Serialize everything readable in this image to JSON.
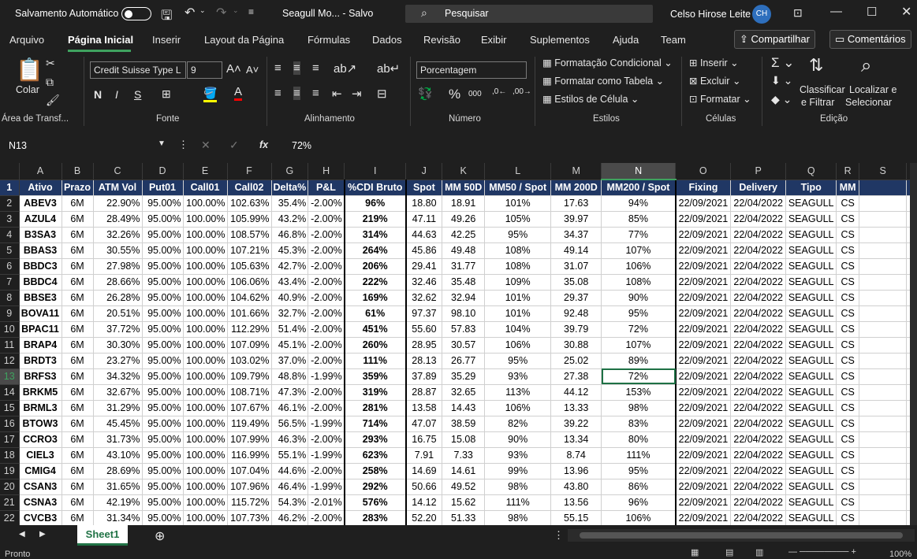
{
  "titlebar": {
    "autosave_label": "Salvamento Automático",
    "doc_title": "Seagull Mo...  -  Salvo",
    "search_placeholder": "Pesquisar",
    "user_name": "Celso Hirose Leite",
    "user_initials": "CH"
  },
  "menu": {
    "items": [
      "Arquivo",
      "Página Inicial",
      "Inserir",
      "Layout da Página",
      "Fórmulas",
      "Dados",
      "Revisão",
      "Exibir",
      "Suplementos",
      "Ajuda",
      "Team"
    ],
    "share": "Compartilhar",
    "comments": "Comentários"
  },
  "ribbon": {
    "paste": "Colar",
    "font_name": "Credit Suisse Type L",
    "font_size": "9",
    "number_format": "Porcentagem",
    "cond_format": "Formatação Condicional",
    "format_table": "Formatar como Tabela",
    "cell_styles": "Estilos de Célula",
    "insert": "Inserir",
    "delete": "Excluir",
    "format": "Formatar",
    "sort1": "Classificar",
    "sort2": "e Filtrar",
    "find1": "Localizar e",
    "find2": "Selecionar",
    "bold": "N",
    "italic": "I",
    "underline": "S",
    "groups": {
      "clipboard": "Área de Transf...",
      "font": "Fonte",
      "alignment": "Alinhamento",
      "number": "Número",
      "styles": "Estilos",
      "cells": "Células",
      "editing": "Edição"
    }
  },
  "formula": {
    "name_box": "N13",
    "fx": "fx",
    "value": "72%"
  },
  "columns": [
    "A",
    "B",
    "C",
    "D",
    "E",
    "F",
    "G",
    "H",
    "I",
    "J",
    "K",
    "L",
    "M",
    "N",
    "O",
    "P",
    "Q",
    "R",
    "S"
  ],
  "headers": [
    "Ativo",
    "Prazo",
    "ATM Vol",
    "Put01",
    "Call01",
    "Call02",
    "Delta%",
    "P&L",
    "%CDI Bruto",
    "Spot",
    "MM 50D",
    "MM50 / Spot",
    "MM 200D",
    "MM200 / Spot",
    "Fixing",
    "Delivery",
    "Tipo",
    "MM",
    ""
  ],
  "rows": [
    [
      "ABEV3",
      "6M",
      "22.90%",
      "95.00%",
      "100.00%",
      "102.63%",
      "35.4%",
      "-2.00%",
      "96%",
      "18.80",
      "18.91",
      "101%",
      "17.63",
      "94%",
      "22/09/2021",
      "22/04/2022",
      "SEAGULL",
      "CS"
    ],
    [
      "AZUL4",
      "6M",
      "28.49%",
      "95.00%",
      "100.00%",
      "105.99%",
      "43.2%",
      "-2.00%",
      "219%",
      "47.11",
      "49.26",
      "105%",
      "39.97",
      "85%",
      "22/09/2021",
      "22/04/2022",
      "SEAGULL",
      "CS"
    ],
    [
      "B3SA3",
      "6M",
      "32.26%",
      "95.00%",
      "100.00%",
      "108.57%",
      "46.8%",
      "-2.00%",
      "314%",
      "44.63",
      "42.25",
      "95%",
      "34.37",
      "77%",
      "22/09/2021",
      "22/04/2022",
      "SEAGULL",
      "CS"
    ],
    [
      "BBAS3",
      "6M",
      "30.55%",
      "95.00%",
      "100.00%",
      "107.21%",
      "45.3%",
      "-2.00%",
      "264%",
      "45.86",
      "49.48",
      "108%",
      "49.14",
      "107%",
      "22/09/2021",
      "22/04/2022",
      "SEAGULL",
      "CS"
    ],
    [
      "BBDC3",
      "6M",
      "27.98%",
      "95.00%",
      "100.00%",
      "105.63%",
      "42.7%",
      "-2.00%",
      "206%",
      "29.41",
      "31.77",
      "108%",
      "31.07",
      "106%",
      "22/09/2021",
      "22/04/2022",
      "SEAGULL",
      "CS"
    ],
    [
      "BBDC4",
      "6M",
      "28.66%",
      "95.00%",
      "100.00%",
      "106.06%",
      "43.4%",
      "-2.00%",
      "222%",
      "32.46",
      "35.48",
      "109%",
      "35.08",
      "108%",
      "22/09/2021",
      "22/04/2022",
      "SEAGULL",
      "CS"
    ],
    [
      "BBSE3",
      "6M",
      "26.28%",
      "95.00%",
      "100.00%",
      "104.62%",
      "40.9%",
      "-2.00%",
      "169%",
      "32.62",
      "32.94",
      "101%",
      "29.37",
      "90%",
      "22/09/2021",
      "22/04/2022",
      "SEAGULL",
      "CS"
    ],
    [
      "BOVA11",
      "6M",
      "20.51%",
      "95.00%",
      "100.00%",
      "101.66%",
      "32.7%",
      "-2.00%",
      "61%",
      "97.37",
      "98.10",
      "101%",
      "92.48",
      "95%",
      "22/09/2021",
      "22/04/2022",
      "SEAGULL",
      "CS"
    ],
    [
      "BPAC11",
      "6M",
      "37.72%",
      "95.00%",
      "100.00%",
      "112.29%",
      "51.4%",
      "-2.00%",
      "451%",
      "55.60",
      "57.83",
      "104%",
      "39.79",
      "72%",
      "22/09/2021",
      "22/04/2022",
      "SEAGULL",
      "CS"
    ],
    [
      "BRAP4",
      "6M",
      "30.30%",
      "95.00%",
      "100.00%",
      "107.09%",
      "45.1%",
      "-2.00%",
      "260%",
      "28.95",
      "30.57",
      "106%",
      "30.88",
      "107%",
      "22/09/2021",
      "22/04/2022",
      "SEAGULL",
      "CS"
    ],
    [
      "BRDT3",
      "6M",
      "23.27%",
      "95.00%",
      "100.00%",
      "103.02%",
      "37.0%",
      "-2.00%",
      "111%",
      "28.13",
      "26.77",
      "95%",
      "25.02",
      "89%",
      "22/09/2021",
      "22/04/2022",
      "SEAGULL",
      "CS"
    ],
    [
      "BRFS3",
      "6M",
      "34.32%",
      "95.00%",
      "100.00%",
      "109.79%",
      "48.8%",
      "-1.99%",
      "359%",
      "37.89",
      "35.29",
      "93%",
      "27.38",
      "72%",
      "22/09/2021",
      "22/04/2022",
      "SEAGULL",
      "CS"
    ],
    [
      "BRKM5",
      "6M",
      "32.67%",
      "95.00%",
      "100.00%",
      "108.71%",
      "47.3%",
      "-2.00%",
      "319%",
      "28.87",
      "32.65",
      "113%",
      "44.12",
      "153%",
      "22/09/2021",
      "22/04/2022",
      "SEAGULL",
      "CS"
    ],
    [
      "BRML3",
      "6M",
      "31.29%",
      "95.00%",
      "100.00%",
      "107.67%",
      "46.1%",
      "-2.00%",
      "281%",
      "13.58",
      "14.43",
      "106%",
      "13.33",
      "98%",
      "22/09/2021",
      "22/04/2022",
      "SEAGULL",
      "CS"
    ],
    [
      "BTOW3",
      "6M",
      "45.45%",
      "95.00%",
      "100.00%",
      "119.49%",
      "56.5%",
      "-1.99%",
      "714%",
      "47.07",
      "38.59",
      "82%",
      "39.22",
      "83%",
      "22/09/2021",
      "22/04/2022",
      "SEAGULL",
      "CS"
    ],
    [
      "CCRO3",
      "6M",
      "31.73%",
      "95.00%",
      "100.00%",
      "107.99%",
      "46.3%",
      "-2.00%",
      "293%",
      "16.75",
      "15.08",
      "90%",
      "13.34",
      "80%",
      "22/09/2021",
      "22/04/2022",
      "SEAGULL",
      "CS"
    ],
    [
      "CIEL3",
      "6M",
      "43.10%",
      "95.00%",
      "100.00%",
      "116.99%",
      "55.1%",
      "-1.99%",
      "623%",
      "7.91",
      "7.33",
      "93%",
      "8.74",
      "111%",
      "22/09/2021",
      "22/04/2022",
      "SEAGULL",
      "CS"
    ],
    [
      "CMIG4",
      "6M",
      "28.69%",
      "95.00%",
      "100.00%",
      "107.04%",
      "44.6%",
      "-2.00%",
      "258%",
      "14.69",
      "14.61",
      "99%",
      "13.96",
      "95%",
      "22/09/2021",
      "22/04/2022",
      "SEAGULL",
      "CS"
    ],
    [
      "CSAN3",
      "6M",
      "31.65%",
      "95.00%",
      "100.00%",
      "107.96%",
      "46.4%",
      "-1.99%",
      "292%",
      "50.66",
      "49.52",
      "98%",
      "43.80",
      "86%",
      "22/09/2021",
      "22/04/2022",
      "SEAGULL",
      "CS"
    ],
    [
      "CSNA3",
      "6M",
      "42.19%",
      "95.00%",
      "100.00%",
      "115.72%",
      "54.3%",
      "-2.01%",
      "576%",
      "14.12",
      "15.62",
      "111%",
      "13.56",
      "96%",
      "22/09/2021",
      "22/04/2022",
      "SEAGULL",
      "CS"
    ],
    [
      "CVCB3",
      "6M",
      "31.34%",
      "95.00%",
      "100.00%",
      "107.73%",
      "46.2%",
      "-2.00%",
      "283%",
      "52.20",
      "51.33",
      "98%",
      "55.15",
      "106%",
      "22/09/2021",
      "22/04/2022",
      "SEAGULL",
      "CS"
    ]
  ],
  "sheet": {
    "tab": "Sheet1",
    "status": "Pronto",
    "zoom": "100%"
  }
}
